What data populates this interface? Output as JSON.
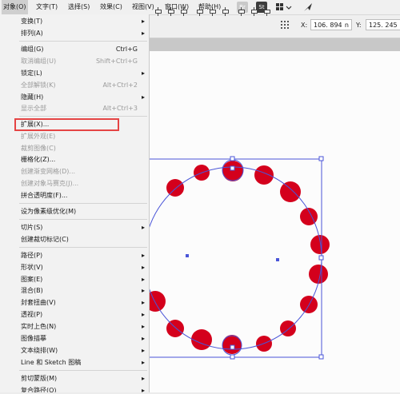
{
  "menubar": {
    "items": [
      "对象(O)",
      "文字(T)",
      "选择(S)",
      "效果(C)",
      "视图(V)",
      "窗口(W)",
      "帮助(H)"
    ],
    "br_badge": "Br",
    "st_badge": "St"
  },
  "control_bar": {
    "x_label": "X:",
    "x_value": "106. 894",
    "x_unit": "n",
    "y_label": "Y:",
    "y_value": "125. 245"
  },
  "object_menu": {
    "items": [
      {
        "label": "变换(T)",
        "shortcut": "",
        "submenu": true,
        "disabled": false
      },
      {
        "label": "排列(A)",
        "shortcut": "",
        "submenu": true,
        "disabled": false
      },
      {
        "label": "编组(G)",
        "shortcut": "Ctrl+G",
        "submenu": false,
        "disabled": false
      },
      {
        "label": "取消编组(U)",
        "shortcut": "Shift+Ctrl+G",
        "submenu": false,
        "disabled": true
      },
      {
        "label": "锁定(L)",
        "shortcut": "",
        "submenu": true,
        "disabled": false
      },
      {
        "label": "全部解锁(K)",
        "shortcut": "Alt+Ctrl+2",
        "submenu": false,
        "disabled": true
      },
      {
        "label": "隐藏(H)",
        "shortcut": "",
        "submenu": true,
        "disabled": false
      },
      {
        "label": "显示全部",
        "shortcut": "Alt+Ctrl+3",
        "submenu": false,
        "disabled": true
      },
      {
        "label": "扩展(X)...",
        "shortcut": "",
        "submenu": false,
        "disabled": false
      },
      {
        "label": "扩展外观(E)",
        "shortcut": "",
        "submenu": false,
        "disabled": true
      },
      {
        "label": "裁剪图像(C)",
        "shortcut": "",
        "submenu": false,
        "disabled": true
      },
      {
        "label": "栅格化(Z)...",
        "shortcut": "",
        "submenu": false,
        "disabled": false
      },
      {
        "label": "创建渐变网格(D)...",
        "shortcut": "",
        "submenu": false,
        "disabled": true
      },
      {
        "label": "创建对象马赛克(J)...",
        "shortcut": "",
        "submenu": false,
        "disabled": true
      },
      {
        "label": "拼合透明度(F)...",
        "shortcut": "",
        "submenu": false,
        "disabled": false
      },
      {
        "label": "设为像素级优化(M)",
        "shortcut": "",
        "submenu": false,
        "disabled": false
      },
      {
        "label": "切片(S)",
        "shortcut": "",
        "submenu": true,
        "disabled": false
      },
      {
        "label": "创建裁切标记(C)",
        "shortcut": "",
        "submenu": false,
        "disabled": false
      },
      {
        "label": "路径(P)",
        "shortcut": "",
        "submenu": true,
        "disabled": false
      },
      {
        "label": "形状(V)",
        "shortcut": "",
        "submenu": true,
        "disabled": false
      },
      {
        "label": "图案(E)",
        "shortcut": "",
        "submenu": true,
        "disabled": false
      },
      {
        "label": "混合(B)",
        "shortcut": "",
        "submenu": true,
        "disabled": false
      },
      {
        "label": "封套扭曲(V)",
        "shortcut": "",
        "submenu": true,
        "disabled": false
      },
      {
        "label": "透视(P)",
        "shortcut": "",
        "submenu": true,
        "disabled": false
      },
      {
        "label": "实时上色(N)",
        "shortcut": "",
        "submenu": true,
        "disabled": false
      },
      {
        "label": "图像描摹",
        "shortcut": "",
        "submenu": true,
        "disabled": false
      },
      {
        "label": "文本绕排(W)",
        "shortcut": "",
        "submenu": true,
        "disabled": false
      },
      {
        "label": "Line 和 Sketch 图稿",
        "shortcut": "",
        "submenu": true,
        "disabled": false
      },
      {
        "label": "剪切蒙版(M)",
        "shortcut": "",
        "submenu": true,
        "disabled": false
      },
      {
        "label": "复合路径(O)",
        "shortcut": "",
        "submenu": true,
        "disabled": false
      }
    ]
  },
  "colors": {
    "dot_fill": "#d4001c",
    "selection": "#4a55d8",
    "highlight_box": "#e54444"
  }
}
